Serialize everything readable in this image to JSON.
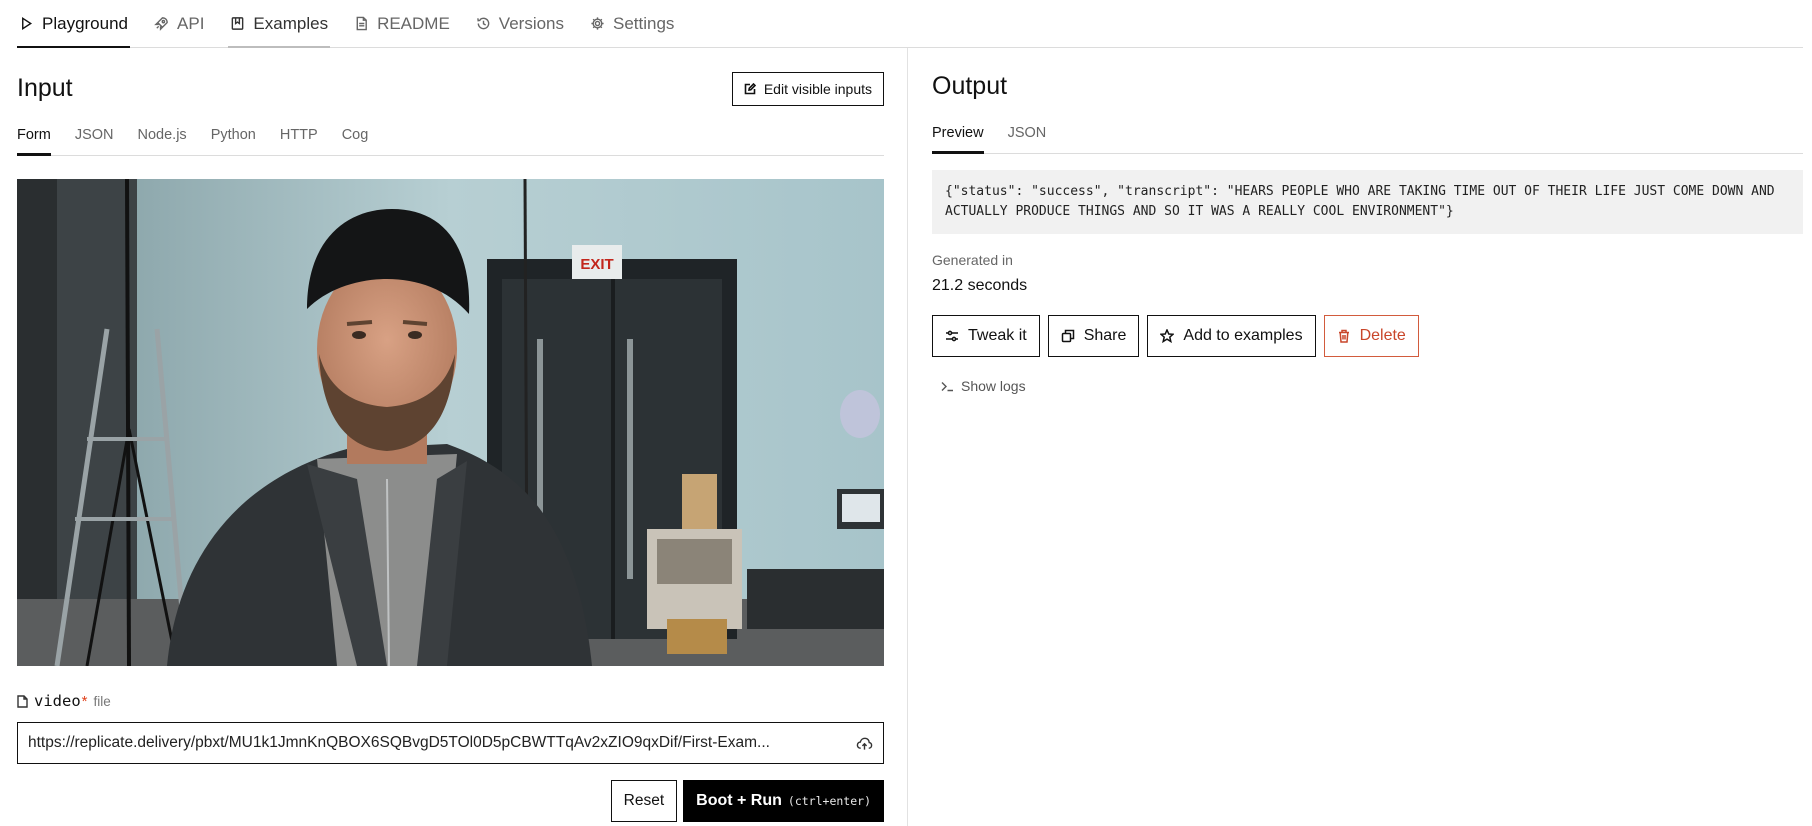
{
  "nav": {
    "tabs": [
      {
        "label": "Playground",
        "icon": "play-icon"
      },
      {
        "label": "API",
        "icon": "rocket-icon"
      },
      {
        "label": "Examples",
        "icon": "bookmark-icon"
      },
      {
        "label": "README",
        "icon": "document-icon"
      },
      {
        "label": "Versions",
        "icon": "history-icon"
      },
      {
        "label": "Settings",
        "icon": "gear-icon"
      }
    ]
  },
  "input": {
    "title": "Input",
    "edit_button": "Edit visible inputs",
    "tabs": [
      "Form",
      "JSON",
      "Node.js",
      "Python",
      "HTTP",
      "Cog"
    ],
    "field": {
      "name": "video",
      "required_mark": "*",
      "type": "file",
      "value": "https://replicate.delivery/pbxt/MU1k1JmnKnQBOX6SQBvgD5TOl0D5pCBWTTqAv2xZIO9qxDif/First-Exam..."
    },
    "reset_label": "Reset",
    "run_label": "Boot + Run",
    "run_shortcut": "(ctrl+enter)"
  },
  "output": {
    "title": "Output",
    "tabs": [
      "Preview",
      "JSON"
    ],
    "json_text": "{\"status\": \"success\", \"transcript\": \"HEARS PEOPLE WHO ARE TAKING TIME OUT OF THEIR LIFE JUST COME DOWN AND ACTUALLY PRODUCE THINGS AND SO IT WAS A REALLY COOL ENVIRONMENT\"}",
    "generated_label": "Generated in",
    "generated_value": "21.2 seconds",
    "buttons": {
      "tweak": "Tweak it",
      "share": "Share",
      "add": "Add to examples",
      "delete": "Delete"
    },
    "logs_label": "Show logs"
  },
  "video_frame": {
    "exit_sign": "EXIT"
  },
  "colors": {
    "accent": "#000000",
    "danger": "#c9462a",
    "code_bg": "#f1f1f1"
  }
}
